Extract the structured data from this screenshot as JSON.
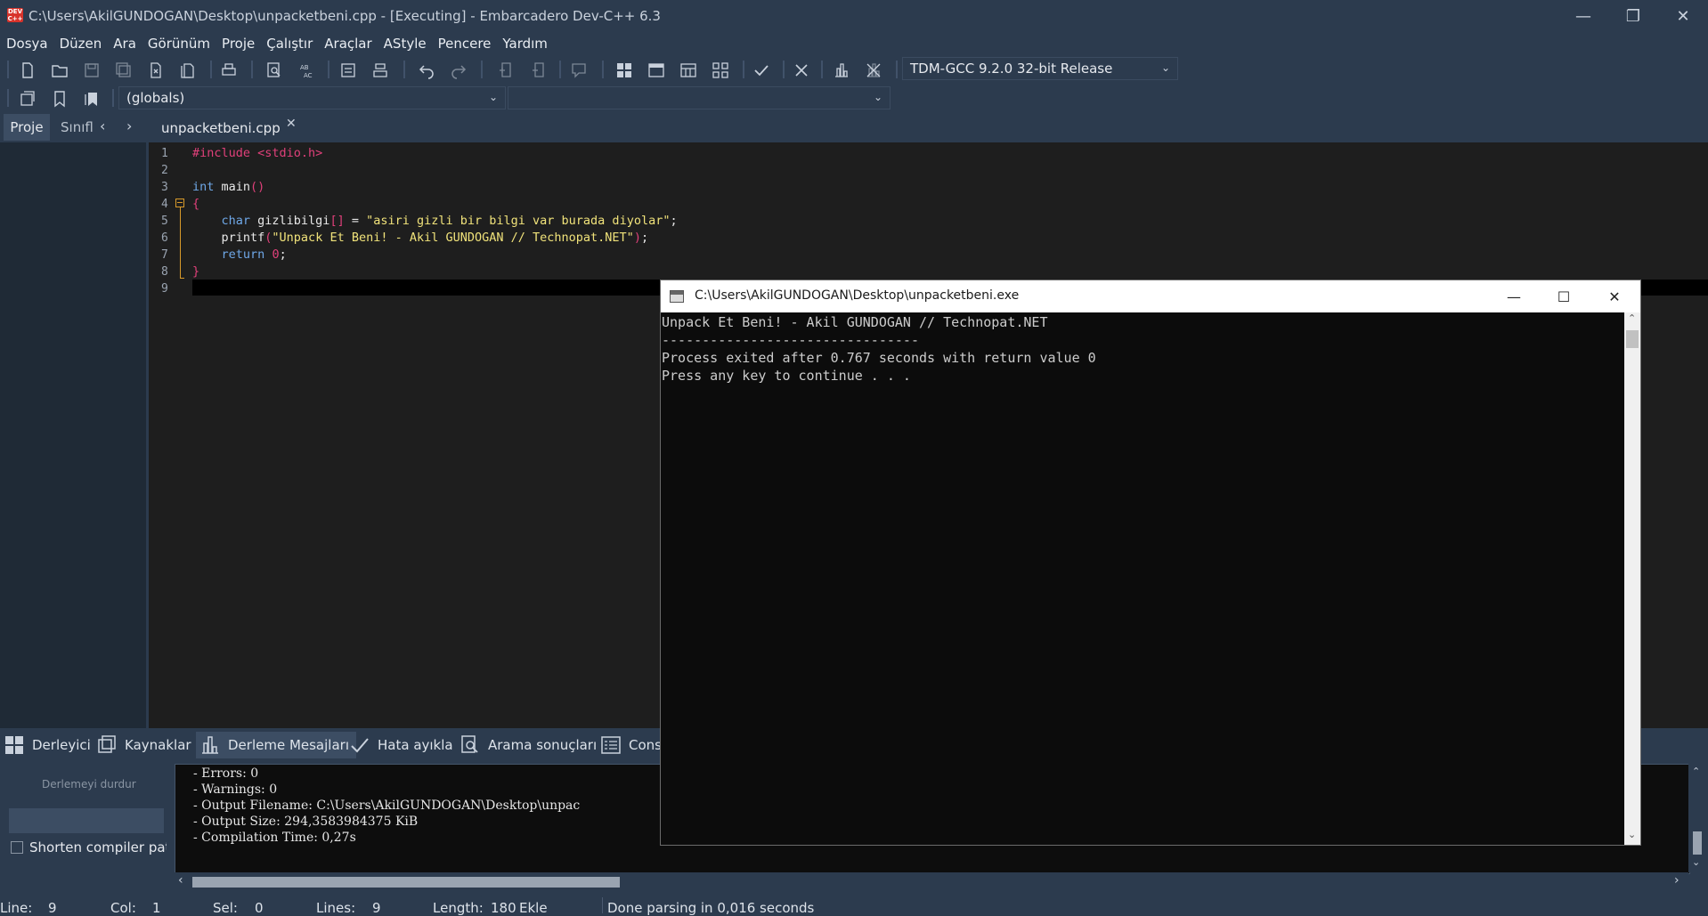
{
  "window": {
    "title": "C:\\Users\\AkilGUNDOGAN\\Desktop\\unpacketbeni.cpp - [Executing] - Embarcadero Dev-C++ 6.3",
    "app_icon_text": "DEV C++"
  },
  "menu": [
    "Dosya",
    "Düzen",
    "Ara",
    "Görünüm",
    "Proje",
    "Çalıştır",
    "Araçlar",
    "AStyle",
    "Pencere",
    "Yardım"
  ],
  "toolbar": {
    "compiler_select": "TDM-GCC 9.2.0 32-bit Release",
    "scope_select": "(globals)",
    "function_select": ""
  },
  "left_panel": {
    "tabs": [
      "Proje",
      "Sınıfl"
    ]
  },
  "editor": {
    "tab_label": "unpacketbeni.cpp",
    "line_numbers": [
      "1",
      "2",
      "3",
      "4",
      "5",
      "6",
      "7",
      "8",
      "9"
    ]
  },
  "bottom_tabs": [
    "Derleyici",
    "Kaynaklar",
    "Derleme Mesajları",
    "Hata ayıkla",
    "Arama sonuçları",
    "Cons"
  ],
  "compile_panel": {
    "stop_button": "Derlemeyi durdur",
    "shorten_paths_label": "Shorten compiler path",
    "log": [
      "- Errors: 0",
      "- Warnings: 0",
      "- Output Filename: C:\\Users\\AkilGUNDOGAN\\Desktop\\unpac",
      "- Output Size: 294,3583984375 KiB",
      "- Compilation Time: 0,27s"
    ]
  },
  "status": {
    "line_label": "Line:",
    "line_value": "9",
    "col_label": "Col:",
    "col_value": "1",
    "sel_label": "Sel:",
    "sel_value": "0",
    "lines_label": "Lines:",
    "lines_value": "9",
    "length_label": "Length:",
    "length_value": "180",
    "mode": "Ekle",
    "message": "Done parsing in 0,016 seconds"
  },
  "console": {
    "title": "C:\\Users\\AkilGUNDOGAN\\Desktop\\unpacketbeni.exe",
    "lines": [
      "Unpack Et Beni! - Akil GUNDOGAN // Technopat.NET",
      "--------------------------------",
      "Process exited after 0.767 seconds with return value 0",
      "Press any key to continue . . ."
    ]
  },
  "colors": {
    "chrome": "#2c3b4e",
    "editor_bg": "#1e1e1e",
    "keyword": "#6fa8e8",
    "preprocessor": "#e0407a",
    "string": "#f0e27a"
  }
}
